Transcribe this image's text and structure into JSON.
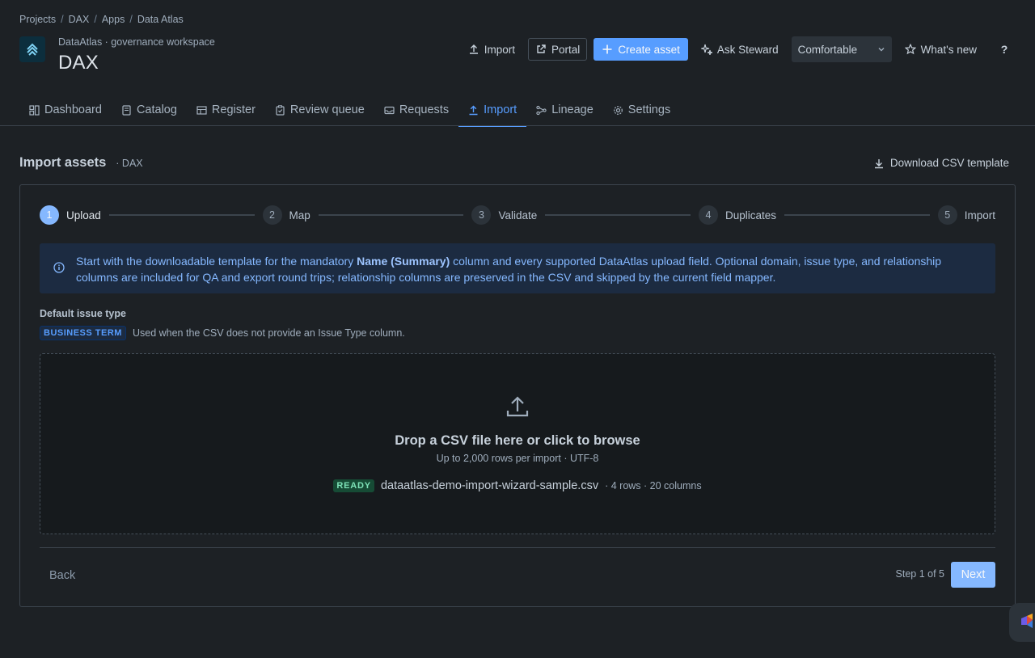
{
  "breadcrumb": [
    "Projects",
    "DAX",
    "Apps",
    "Data Atlas"
  ],
  "app": {
    "subtitle": "DataAtlas · governance workspace",
    "title": "DAX"
  },
  "header_actions": {
    "import": "Import",
    "portal": "Portal",
    "create_asset": "Create asset",
    "ask_steward": "Ask Steward",
    "density": "Comfortable",
    "whats_new": "What's new",
    "help": "?"
  },
  "tabs": [
    {
      "label": "Dashboard",
      "icon": "dashboard-icon"
    },
    {
      "label": "Catalog",
      "icon": "book-icon"
    },
    {
      "label": "Register",
      "icon": "table-icon"
    },
    {
      "label": "Review queue",
      "icon": "clipboard-check-icon"
    },
    {
      "label": "Requests",
      "icon": "inbox-icon"
    },
    {
      "label": "Import",
      "icon": "upload-icon",
      "active": true
    },
    {
      "label": "Lineage",
      "icon": "lineage-icon"
    },
    {
      "label": "Settings",
      "icon": "gear-icon"
    }
  ],
  "section": {
    "title": "Import assets",
    "context": "· DAX",
    "download_template": "Download CSV template"
  },
  "steps": [
    {
      "num": "1",
      "label": "Upload",
      "active": true
    },
    {
      "num": "2",
      "label": "Map"
    },
    {
      "num": "3",
      "label": "Validate"
    },
    {
      "num": "4",
      "label": "Duplicates"
    },
    {
      "num": "5",
      "label": "Import"
    }
  ],
  "info": {
    "before": "Start with the downloadable template for the mandatory ",
    "bold": "Name (Summary)",
    "after": " column and every supported DataAtlas upload field. Optional domain, issue type, and relationship columns are included for QA and export round trips; relationship columns are preserved in the CSV and skipped by the current field mapper."
  },
  "default_issue_type": {
    "label": "Default issue type",
    "value": "BUSINESS TERM",
    "help": "Used when the CSV does not provide an Issue Type column."
  },
  "dropzone": {
    "title": "Drop a CSV file here or click to browse",
    "subtitle": "Up to 2,000 rows per import · UTF-8",
    "status": "READY",
    "filename": "dataatlas-demo-import-wizard-sample.csv",
    "meta": "· 4 rows · 20 columns"
  },
  "footer": {
    "back": "Back",
    "step_count": "Step 1 of 5",
    "next": "Next"
  },
  "colors": {
    "accent": "#579dff",
    "background": "#1d2125",
    "ready": "#7ee2b8"
  }
}
